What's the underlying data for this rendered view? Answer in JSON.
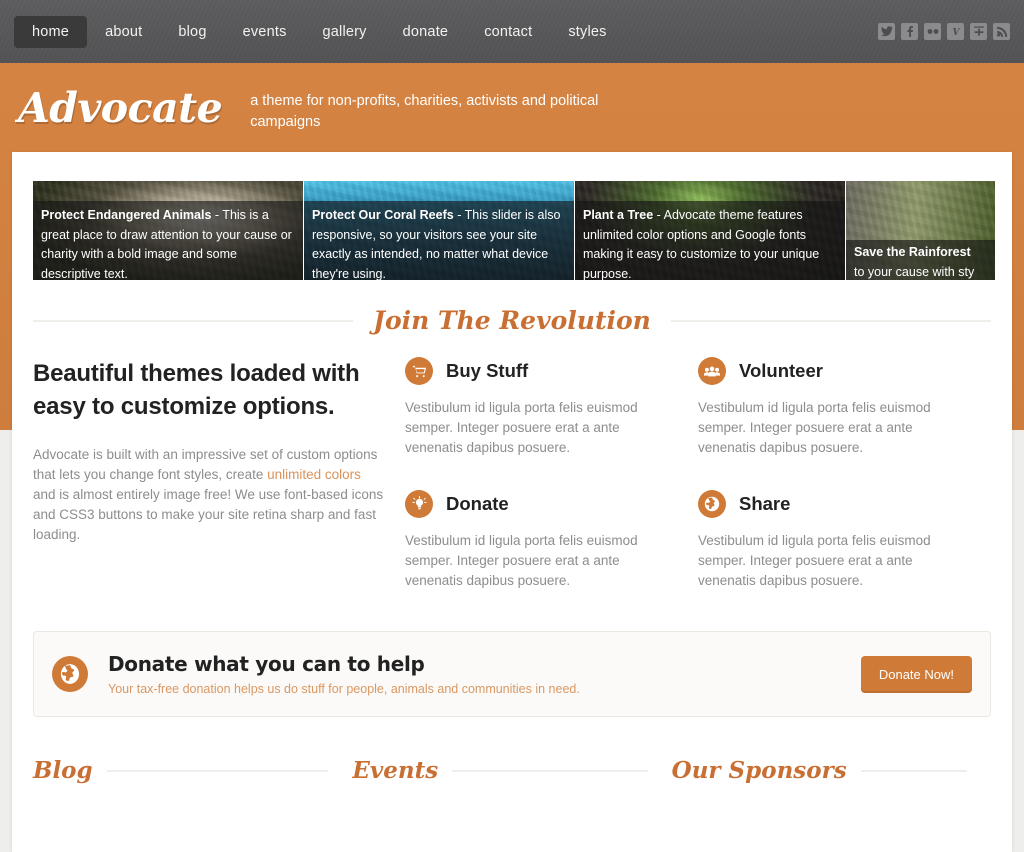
{
  "nav": {
    "items": [
      {
        "label": "home",
        "active": true
      },
      {
        "label": "about",
        "active": false
      },
      {
        "label": "blog",
        "active": false
      },
      {
        "label": "events",
        "active": false
      },
      {
        "label": "gallery",
        "active": false
      },
      {
        "label": "donate",
        "active": false
      },
      {
        "label": "contact",
        "active": false
      },
      {
        "label": "styles",
        "active": false
      }
    ],
    "social": [
      {
        "name": "twitter-icon"
      },
      {
        "name": "facebook-icon"
      },
      {
        "name": "flickr-icon"
      },
      {
        "name": "vimeo-icon"
      },
      {
        "name": "google-plus-icon"
      },
      {
        "name": "rss-icon"
      }
    ]
  },
  "header": {
    "logo": "Advocate",
    "tagline": "a theme for non-profits, charities, activists and political campaigns"
  },
  "slider": {
    "slides": [
      {
        "title": "Protect Endangered Animals",
        "body": " - This is a great place to draw attention to your cause or charity with a bold image and some descriptive text.",
        "image_alt": "panda-in-bamboo"
      },
      {
        "title": "Protect Our Coral Reefs",
        "body": " - This slider is also responsive, so your visitors see your site exactly as intended, no matter what device they're using.",
        "image_alt": "coral-reef-fish"
      },
      {
        "title": "Plant a Tree",
        "body": " - Advocate theme features unlimited color options and Google fonts making it easy to customize to your unique purpose.",
        "image_alt": "seedling-in-soil"
      },
      {
        "title": "Save the Rainforest",
        "body": "to your cause with sty",
        "image_alt": "rainforest-plants"
      }
    ]
  },
  "section_heading": "Join The Revolution",
  "left": {
    "heading": "Beautiful themes loaded with easy to customize options.",
    "body_part1": "Advocate is built with an impressive set of custom options that lets you change font styles, create ",
    "link": "unlimited colors",
    "body_part2": " and is almost entirely image free! We use font-based icons and CSS3 buttons to make your site retina sharp and fast loading."
  },
  "features": [
    {
      "icon": "shopping-cart-icon",
      "title": "Buy Stuff",
      "body": "Vestibulum id ligula porta felis euismod semper. Integer posuere erat a ante venenatis dapibus posuere."
    },
    {
      "icon": "people-group-icon",
      "title": "Volunteer",
      "body": "Vestibulum id ligula porta felis euismod semper. Integer posuere erat a ante venenatis dapibus posuere."
    },
    {
      "icon": "lightbulb-icon",
      "title": "Donate",
      "body": "Vestibulum id ligula porta felis euismod semper. Integer posuere erat a ante venenatis dapibus posuere."
    },
    {
      "icon": "globe-icon",
      "title": "Share",
      "body": "Vestibulum id ligula porta felis euismod semper. Integer posuere erat a ante venenatis dapibus posuere."
    }
  ],
  "cta": {
    "icon": "globe-icon",
    "title": "Donate what you can to help",
    "subtitle": "Your tax-free donation helps us do stuff for people, animals and communities in need.",
    "button": "Donate Now!"
  },
  "bottom_sections": [
    {
      "title": "Blog"
    },
    {
      "title": "Events"
    },
    {
      "title": "Our Sponsors"
    }
  ],
  "colors": {
    "accent": "#cf7a36",
    "band": "#d4813f",
    "nav_bg": "#58585a",
    "nav_active": "#3a3a3a",
    "script_heading": "#c96f33",
    "muted_text": "#8d8d8d",
    "link": "#d9925a"
  }
}
